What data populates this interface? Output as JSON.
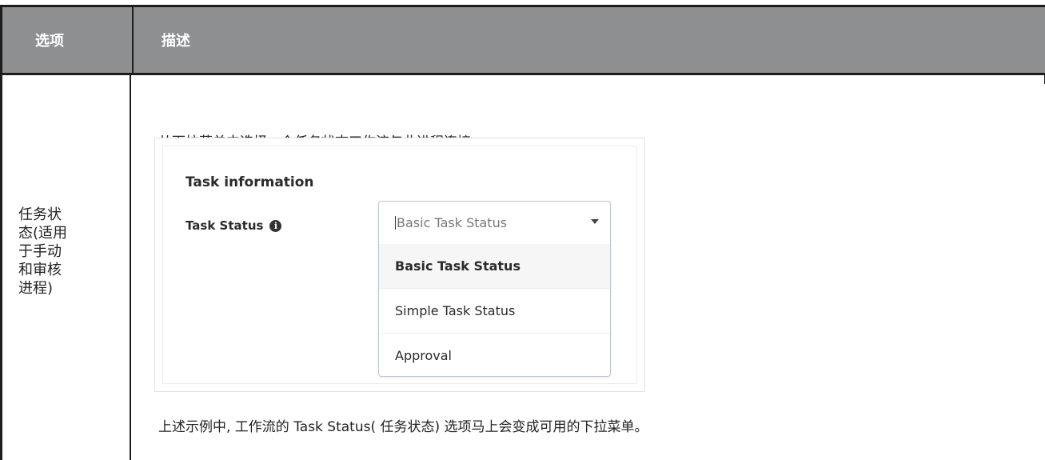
{
  "header": {
    "col_option": "选项",
    "col_description": "描述"
  },
  "row": {
    "option_lines": [
      "任务状",
      "态(适用",
      "于手动",
      "和审核",
      "进程)"
    ],
    "intro_text": "从下拉菜单中选择一个任务状态工作流与此进程连接。",
    "outro_text": "上述示例中, 工作流的 Task Status( 任务状态) 选项马上会变成可用的下拉菜单。"
  },
  "screenshot": {
    "section_title": "Task information",
    "field_label": "Task Status",
    "info_icon": "info-circle-icon",
    "dropdown": {
      "current_value": "Basic Task Status",
      "options": [
        "Basic Task Status",
        "Simple Task Status",
        "Approval"
      ],
      "selected_index": 0
    }
  }
}
